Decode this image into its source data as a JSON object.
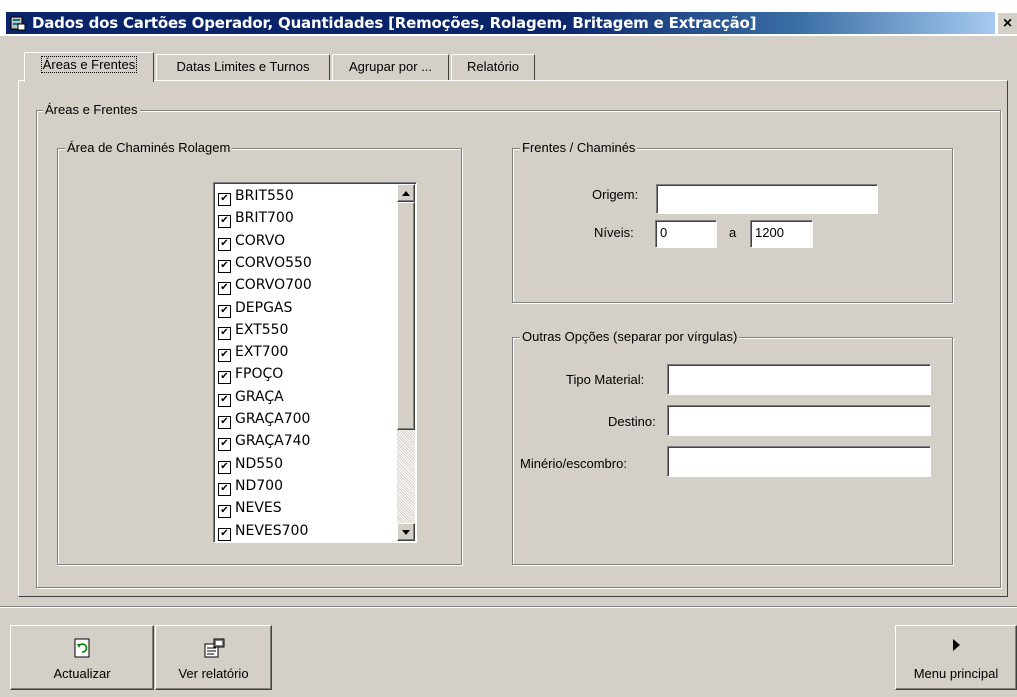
{
  "window": {
    "title": "Dados dos Cartões Operador, Quantidades [Remoções, Rolagem, Britagem e Extracção]",
    "close_label": "×"
  },
  "tabs": [
    {
      "label": "Áreas e Frentes",
      "active": true
    },
    {
      "label": "Datas Limites e Turnos",
      "active": false
    },
    {
      "label": "Agrupar por ...",
      "active": false
    },
    {
      "label": "Relatório",
      "active": false
    }
  ],
  "areas_frentes": {
    "frame_label": "Áreas e Frentes",
    "area_group": {
      "label": "Área de Chaminés Rolagem",
      "items": [
        {
          "label": "BRIT550",
          "checked": true
        },
        {
          "label": "BRIT700",
          "checked": true
        },
        {
          "label": "CORVO",
          "checked": true
        },
        {
          "label": "CORVO550",
          "checked": true
        },
        {
          "label": "CORVO700",
          "checked": true
        },
        {
          "label": "DEPGAS",
          "checked": true
        },
        {
          "label": "EXT550",
          "checked": true
        },
        {
          "label": "EXT700",
          "checked": true
        },
        {
          "label": "FPOÇO",
          "checked": true
        },
        {
          "label": "GRAÇA",
          "checked": true
        },
        {
          "label": "GRAÇA700",
          "checked": true
        },
        {
          "label": "GRAÇA740",
          "checked": true
        },
        {
          "label": "ND550",
          "checked": true
        },
        {
          "label": "ND700",
          "checked": true
        },
        {
          "label": "NEVES",
          "checked": true
        },
        {
          "label": "NEVES700",
          "checked": true
        }
      ]
    },
    "frentes_group": {
      "label": "Frentes / Chaminés",
      "origem_label": "Origem:",
      "origem_value": "",
      "niveis_label": "Níveis:",
      "niveis_from": "0",
      "niveis_sep": "a",
      "niveis_to": "1200"
    },
    "outras_group": {
      "label": "Outras Opções (separar por vírgulas)",
      "tipo_material_label": "Tipo Material:",
      "tipo_material_value": "",
      "destino_label": "Destino:",
      "destino_value": "",
      "minerio_label": "Minério/escombro:",
      "minerio_value": ""
    }
  },
  "toolbar": {
    "actualizar_label": "Actualizar",
    "ver_relatorio_label": "Ver relatório",
    "menu_principal_label": "Menu principal"
  },
  "check_glyph": "✔"
}
